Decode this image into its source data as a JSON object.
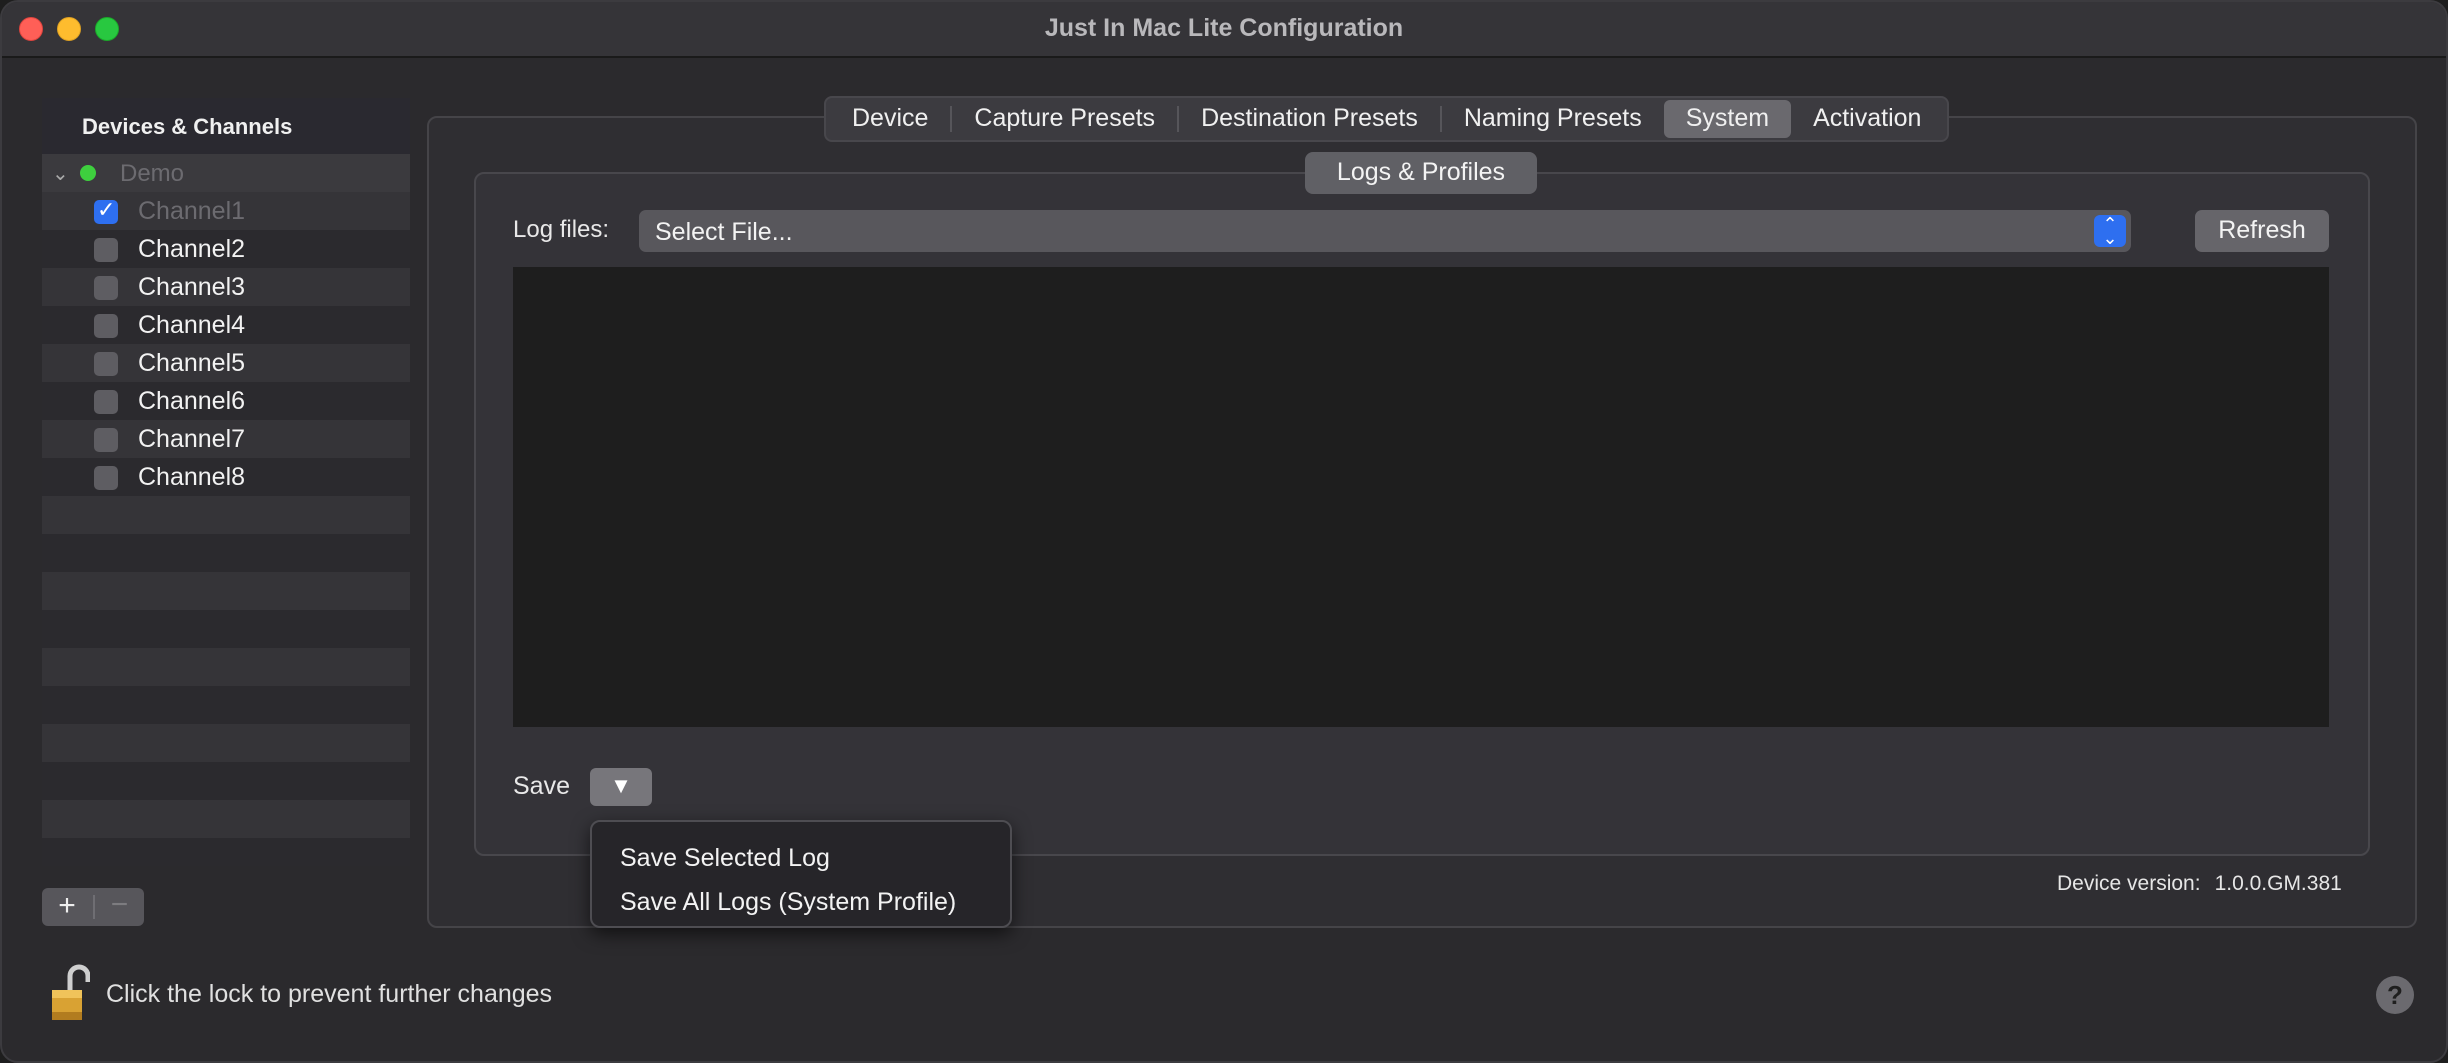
{
  "window": {
    "title": "Just In Mac Lite Configuration"
  },
  "sidebar": {
    "header": "Devices & Channels",
    "device": {
      "label": "Demo",
      "status_color": "#3ecf3e"
    },
    "channels": [
      {
        "label": "Channel1",
        "checked": true
      },
      {
        "label": "Channel2",
        "checked": false
      },
      {
        "label": "Channel3",
        "checked": false
      },
      {
        "label": "Channel4",
        "checked": false
      },
      {
        "label": "Channel5",
        "checked": false
      },
      {
        "label": "Channel6",
        "checked": false
      },
      {
        "label": "Channel7",
        "checked": false
      },
      {
        "label": "Channel8",
        "checked": false
      }
    ],
    "add_label": "+",
    "remove_label": "−"
  },
  "tabs": [
    {
      "label": "Device",
      "active": false
    },
    {
      "label": "Capture Presets",
      "active": false
    },
    {
      "label": "Destination Presets",
      "active": false
    },
    {
      "label": "Naming Presets",
      "active": false
    },
    {
      "label": "System",
      "active": true
    },
    {
      "label": "Activation",
      "active": false
    }
  ],
  "system": {
    "group_title": "Logs & Profiles",
    "log_files_label": "Log files:",
    "log_select_value": "Select File...",
    "refresh_label": "Refresh",
    "save_label": "Save",
    "save_menu": [
      "Save Selected Log",
      "Save All Logs (System Profile)"
    ],
    "device_version_label": "Device version:",
    "device_version_value": "1.0.0.GM.381"
  },
  "footer": {
    "lock_text": "Click the lock to prevent further changes",
    "help_label": "?"
  },
  "colors": {
    "accent": "#2e6ff0",
    "background": "#2b2a2d"
  }
}
